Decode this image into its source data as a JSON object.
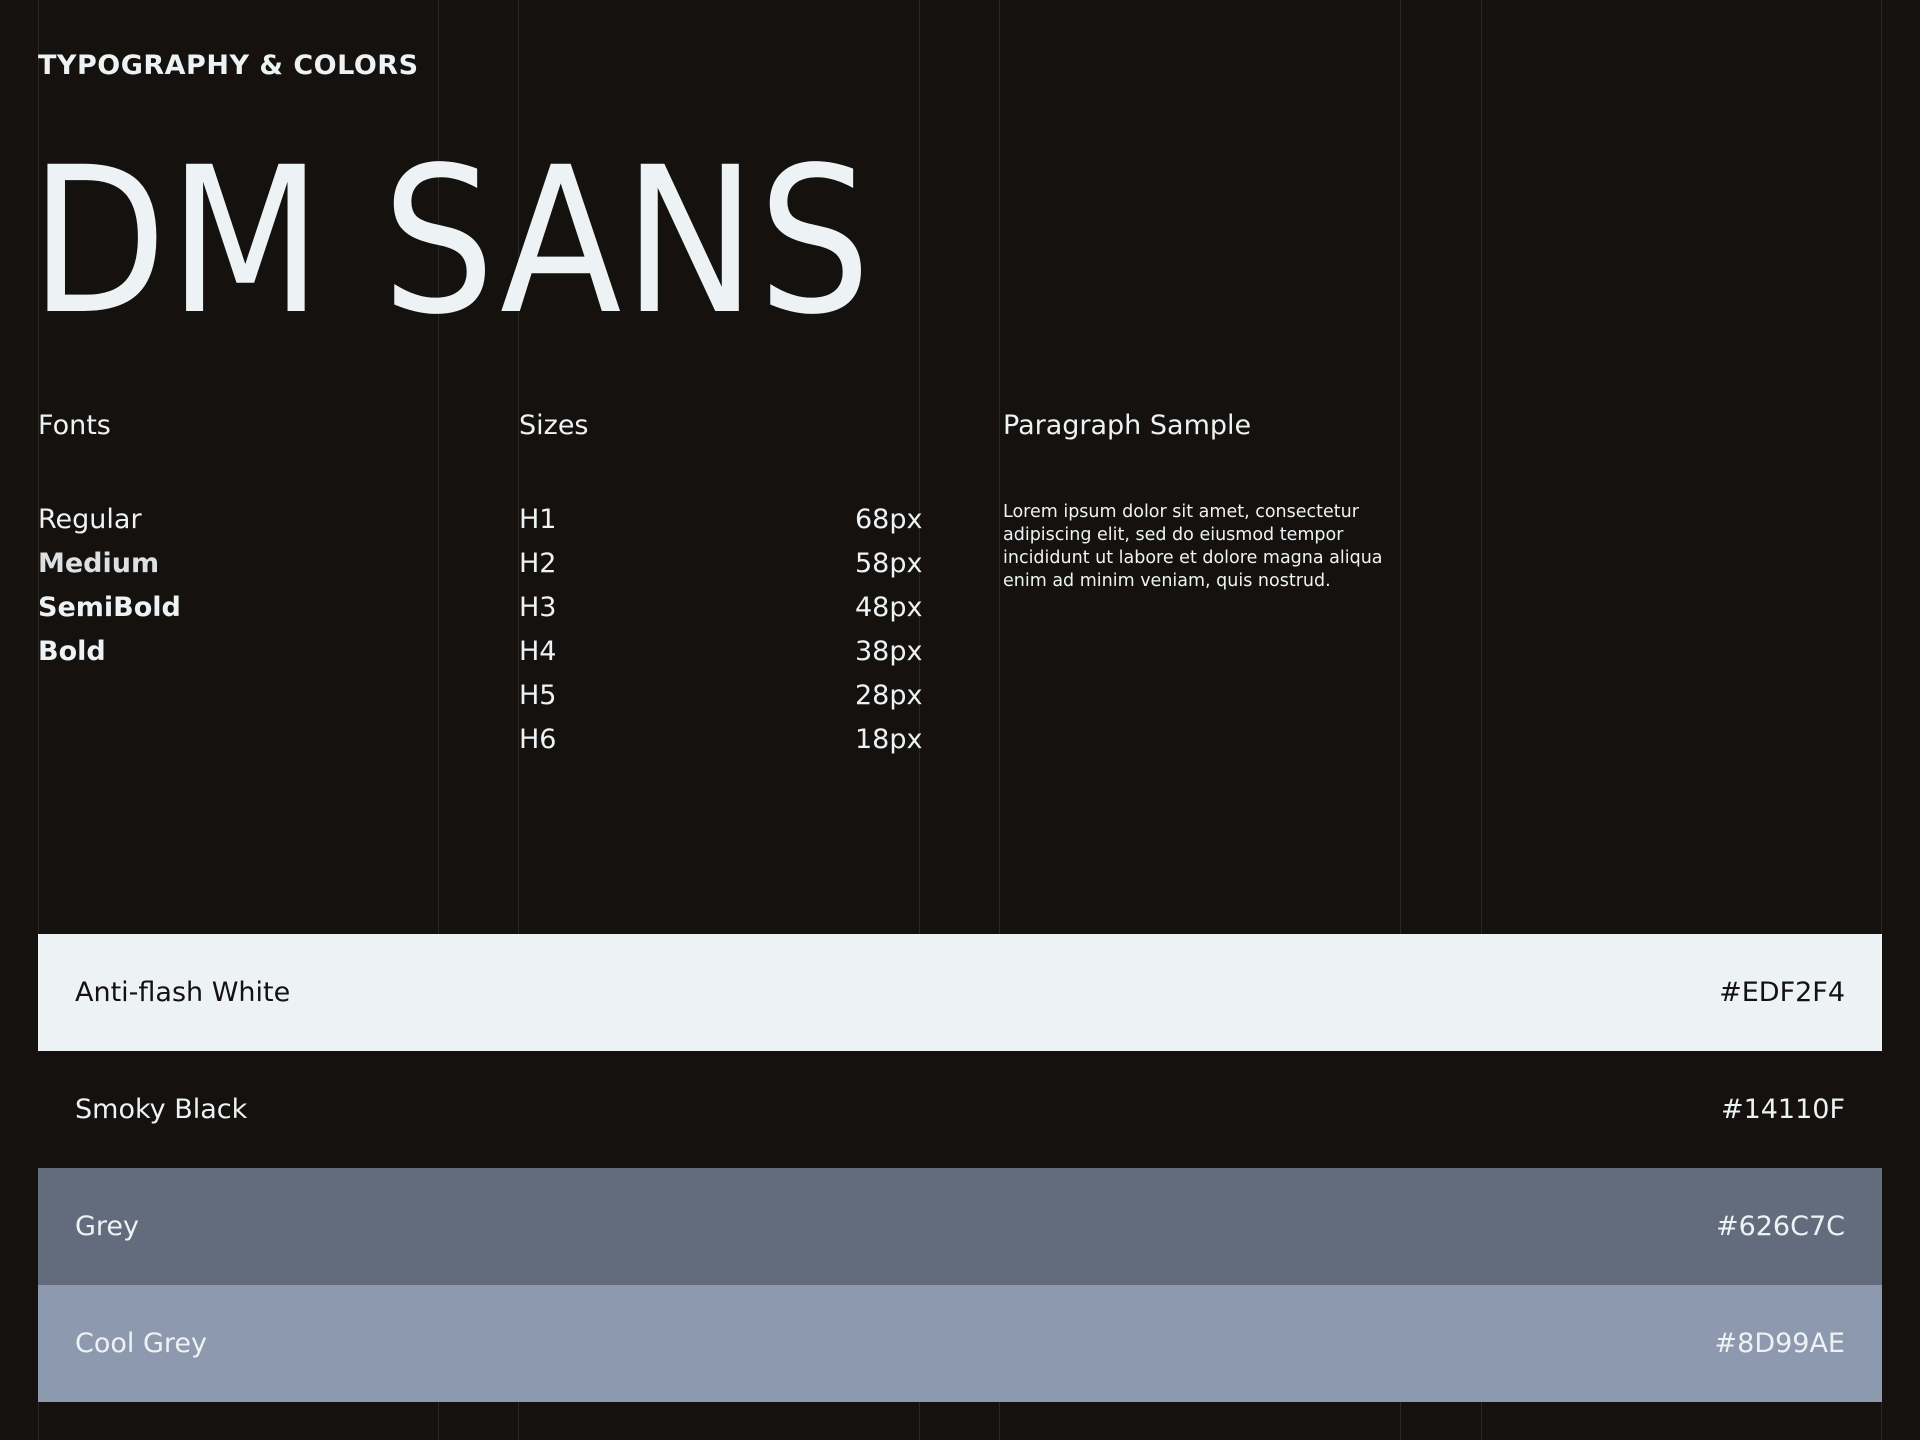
{
  "header": {
    "section_label": "TYPOGRAPHY & COLORS",
    "font_name": "DM SANS"
  },
  "fonts": {
    "heading": "Fonts",
    "weights": [
      "Regular",
      "Medium",
      "SemiBold",
      "Bold"
    ]
  },
  "sizes": {
    "heading": "Sizes",
    "items": [
      {
        "label": "H1",
        "value": "68px"
      },
      {
        "label": "H2",
        "value": "58px"
      },
      {
        "label": "H3",
        "value": "48px"
      },
      {
        "label": "H4",
        "value": "38px"
      },
      {
        "label": "H5",
        "value": "28px"
      },
      {
        "label": "H6",
        "value": "18px"
      }
    ]
  },
  "paragraph": {
    "heading": "Paragraph Sample",
    "text": "Lorem ipsum dolor sit amet, consectetur adipiscing elit, sed do eiusmod  tempor incididunt ut labore et dolore magna aliqua enim ad minim  veniam, quis nostrud."
  },
  "colors": [
    {
      "name": "Anti-flash White",
      "hex": "#EDF2F4",
      "text_color": "#14110F"
    },
    {
      "name": "Smoky Black",
      "hex": "#14110F",
      "text_color": "#EDF2F4"
    },
    {
      "name": "Grey",
      "hex": "#626C7C",
      "text_color": "#EDF2F4"
    },
    {
      "name": "Cool Grey",
      "hex": "#8D99AE",
      "text_color": "#EDF2F4"
    }
  ]
}
